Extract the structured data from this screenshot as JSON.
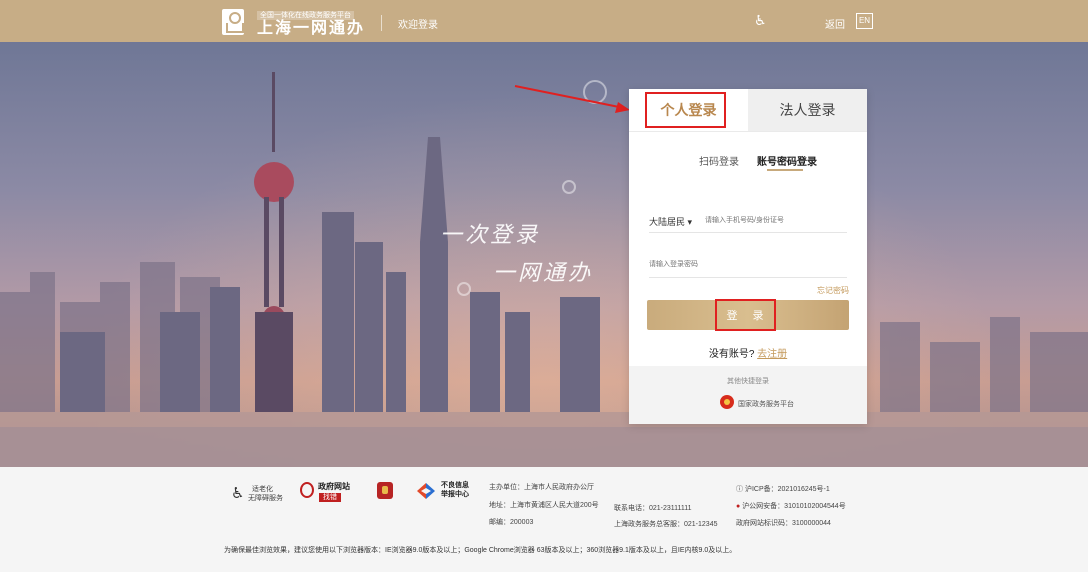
{
  "header": {
    "brand_sub": "全国一体化在线政务服务平台",
    "brand_main": "上海一网通办",
    "welcome": "欢迎登录",
    "a11y_icon": "accessibility-icon",
    "back": "返回",
    "lang": "EN",
    "color": "#c7ad86"
  },
  "hero": {
    "slogan_1": "一次登录",
    "slogan_2": "一网通办"
  },
  "login": {
    "tab_personal": "个人登录",
    "tab_legal": "法人登录",
    "mode_qr": "扫码登录",
    "mode_password": "账号密码登录",
    "region": "大陆居民 ▾",
    "id_placeholder": "请输入手机号码/身份证号",
    "password_placeholder": "请输入登录密码",
    "forgot": "忘记密码",
    "submit": "登 录",
    "no_account": "没有账号?",
    "register": "去注册",
    "quick_title": "其他快捷登录",
    "national_platform": "国家政务服务平台",
    "accent_color": "#c49a5c"
  },
  "footer": {
    "a11y_label": "适老化",
    "a11y_label2": "无障碍服务",
    "gov_site": "政府网站",
    "gov_error": "找错",
    "report_label": "不良信息",
    "report_label2": "举报中心",
    "host": "主办单位：上海市人民政府办公厅",
    "address": "地址：上海市黄浦区人民大道200号",
    "postcode": "邮编：200003",
    "phone": "联系电话：021-23111111",
    "hotline": "上海政务服务总客服：021-12345",
    "icp": "沪ICP备：2021016245号-1",
    "police": "沪公网安备：31010102004544号",
    "site_code": "政府网站标识码：3100000044",
    "browser_note": "为确保最佳浏览效果，建议您使用以下浏览器版本：IE浏览器9.0版本及以上；Google Chrome浏览器 63版本及以上；360浏览器9.1版本及以上，且IE内核9.0及以上。"
  }
}
